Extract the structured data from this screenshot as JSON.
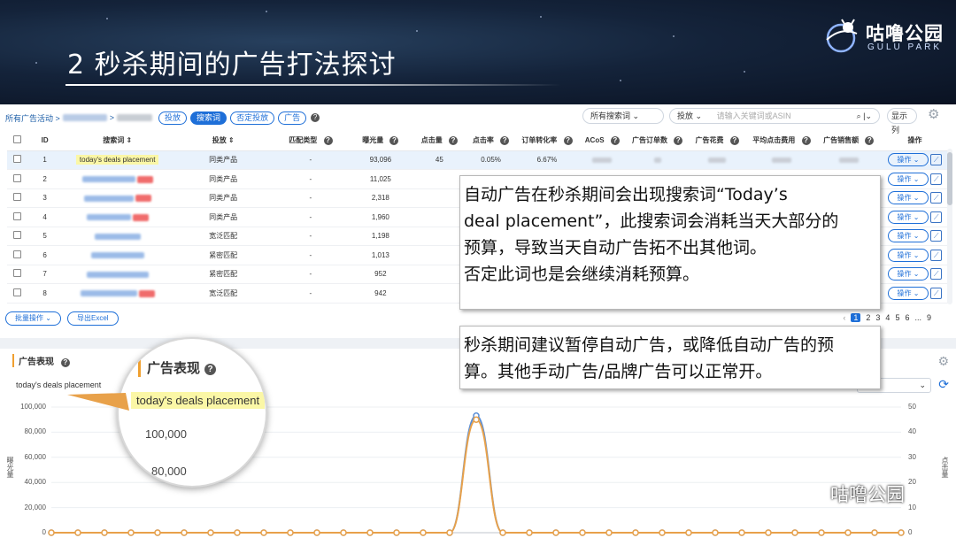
{
  "slide": {
    "title": "2  秒杀期间的广告打法探讨",
    "logo_cn": "咕噜公园",
    "logo_en": "GULU PARK",
    "watermark": "咕噜公园"
  },
  "breadcrumb": {
    "root": "所有广告活动 >",
    "sep": ">",
    "tabs": [
      "投放",
      "搜索词",
      "否定投放",
      "广告"
    ],
    "active_tab": "搜索词"
  },
  "toolbar": {
    "search_scope": "所有搜索词",
    "target_select": "投放",
    "search_placeholder": "请输入关键词或ASIN",
    "columns_button": "显示列"
  },
  "table": {
    "headers": [
      "ID",
      "搜索词",
      "投放",
      "匹配类型",
      "曝光量",
      "点击量",
      "点击率",
      "订单转化率",
      "ACoS",
      "广告订单数",
      "广告花费",
      "平均点击费用",
      "广告销售额",
      "操作"
    ],
    "rows": [
      {
        "id": "1",
        "term": "today's deals placement",
        "target": "同类产品",
        "match": "-",
        "impressions": "93,096",
        "clicks": "45",
        "ctr": "0.05%",
        "cvr": "6.67%",
        "highlight": true
      },
      {
        "id": "2",
        "term": "",
        "target": "同类产品",
        "match": "-",
        "impressions": "11,025",
        "clicks": "",
        "ctr": "",
        "cvr": "",
        "highlight": false
      },
      {
        "id": "3",
        "term": "",
        "target": "同类产品",
        "match": "-",
        "impressions": "2,318",
        "clicks": "",
        "ctr": "",
        "cvr": "",
        "highlight": false
      },
      {
        "id": "4",
        "term": "",
        "target": "同类产品",
        "match": "-",
        "impressions": "1,960",
        "clicks": "",
        "ctr": "",
        "cvr": "",
        "highlight": false
      },
      {
        "id": "5",
        "term": "",
        "target": "宽泛匹配",
        "match": "-",
        "impressions": "1,198",
        "clicks": "",
        "ctr": "",
        "cvr": "",
        "highlight": false
      },
      {
        "id": "6",
        "term": "",
        "target": "紧密匹配",
        "match": "-",
        "impressions": "1,013",
        "clicks": "",
        "ctr": "",
        "cvr": "",
        "highlight": false
      },
      {
        "id": "7",
        "term": "",
        "target": "紧密匹配",
        "match": "-",
        "impressions": "952",
        "clicks": "",
        "ctr": "",
        "cvr": "",
        "highlight": false
      },
      {
        "id": "8",
        "term": "",
        "target": "宽泛匹配",
        "match": "-",
        "impressions": "942",
        "clicks": "",
        "ctr": "",
        "cvr": "",
        "highlight": false
      }
    ],
    "op_label": "操作",
    "op_caret": "⌄"
  },
  "footer": {
    "bulk_button": "批量操作",
    "export_button": "导出Excel",
    "pages": [
      "1",
      "2",
      "3",
      "4",
      "5",
      "6",
      "...",
      "9"
    ],
    "current_page": "1"
  },
  "callouts": {
    "first": [
      "自动广告在秒杀期间会出现搜索词“Today’s",
      "deal placement”，此搜索词会消耗当天大部分的",
      "预算，导致当天自动广告拓不出其他词。",
      "否定此词也是会继续消耗预算。"
    ],
    "second": [
      "秒杀期间建议暂停自动广告，或降低自动广告的预",
      "算。其他手动广告/品牌广告可以正常开。"
    ]
  },
  "perf": {
    "title": "广告表现",
    "keyword": "today's deals placement",
    "left_axis_name": "曝光量",
    "right_axis_name": "点击量",
    "left_ticks": [
      "100,000",
      "80,000",
      "60,000",
      "40,000",
      "20,000",
      "0"
    ],
    "right_ticks": [
      "50",
      "40",
      "30",
      "20",
      "10",
      "0"
    ]
  },
  "magnifier": {
    "title": "广告表现",
    "keyword": "today's deals placement",
    "v1": "100,000",
    "v2": "80,000"
  },
  "chart_data": {
    "type": "line",
    "series": [
      {
        "name": "曝光量",
        "color": "#5b8fd6",
        "axis": "left",
        "values": [
          0,
          0,
          0,
          0,
          0,
          0,
          0,
          0,
          0,
          0,
          0,
          0,
          0,
          0,
          0,
          0,
          93096,
          0,
          0,
          0,
          0,
          0,
          0,
          0,
          0,
          0,
          0,
          0,
          0,
          0,
          0,
          0,
          0
        ]
      },
      {
        "name": "点击量",
        "color": "#e8a14a",
        "axis": "right",
        "values": [
          0,
          0,
          0,
          0,
          0,
          0,
          0,
          0,
          0,
          0,
          0,
          0,
          0,
          0,
          0,
          0,
          45,
          0,
          0,
          0,
          0,
          0,
          0,
          0,
          0,
          0,
          0,
          0,
          0,
          0,
          0,
          0,
          0
        ]
      }
    ],
    "ylim_left": [
      0,
      100000
    ],
    "ylim_right": [
      0,
      50
    ],
    "grid": true
  },
  "colors": {
    "accent": "#1e6fd8",
    "highlight": "#fbf7a6",
    "orange": "#e8a14a"
  }
}
